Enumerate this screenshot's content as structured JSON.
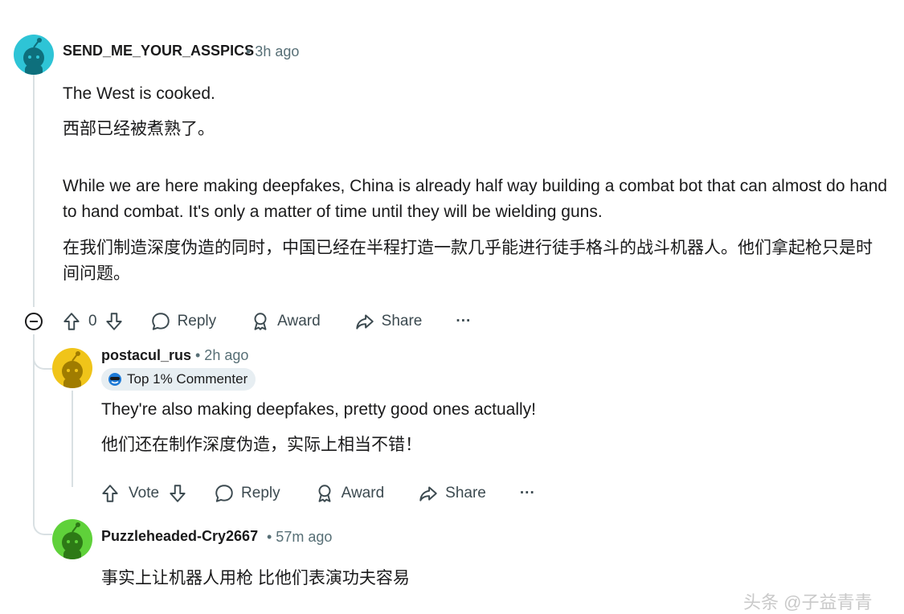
{
  "comment1": {
    "username": "SEND_ME_YOUR_ASSPICS",
    "time": "• 3h ago",
    "lines": [
      "The West is cooked.",
      "西部已经被煮熟了。",
      "While we are here making deepfakes, China is already half way building a combat bot that can almost do hand to hand combat. It's only a matter of time until they will be wielding guns.",
      "在我们制造深度伪造的同时，中国已经在半程打造一款几乎能进行徒手格斗的战斗机器人。他们拿起枪只是时间问题。"
    ],
    "vote_count": "0",
    "reply_label": "Reply",
    "award_label": "Award",
    "share_label": "Share",
    "more_label": "···",
    "avatar_color": "#2ec4d6"
  },
  "comment2": {
    "username": "postacul_rus",
    "time": "• 2h ago",
    "badge": "Top 1% Commenter",
    "lines": [
      "They're also making deepfakes, pretty good ones actually!",
      "他们还在制作深度伪造，实际上相当不错！"
    ],
    "vote_label": "Vote",
    "reply_label": "Reply",
    "award_label": "Award",
    "share_label": "Share",
    "more_label": "···",
    "avatar_color": "#f0c419"
  },
  "comment3": {
    "username": "Puzzleheaded-Cry2667",
    "time": "• 57m ago",
    "lines": [
      "事实上让机器人用枪 比他们表演功夫容易"
    ],
    "avatar_color": "#5fd13a"
  },
  "watermark": "头条 @子益青青"
}
